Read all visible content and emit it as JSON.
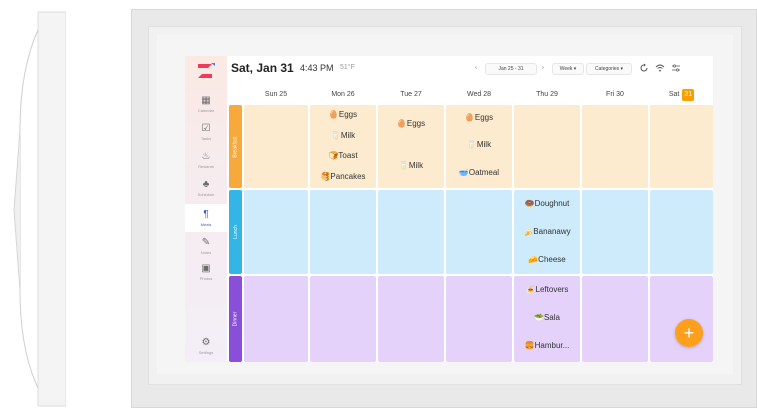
{
  "header": {
    "date": "Sat, Jan 31",
    "time": "4:43 PM",
    "weather": "51°F",
    "prev_label": "‹",
    "range_label": "Jan 25 - 31",
    "next_label": "›",
    "view_label": "Week ▾",
    "categories_label": "Categories ▾",
    "refresh_icon": "refresh-icon",
    "wifi_icon": "wifi-icon",
    "settings_icon": "sliders-icon"
  },
  "sidebar": {
    "items": [
      {
        "label": "Calendar",
        "icon": "calendar-icon",
        "glyph": "▦"
      },
      {
        "label": "Tasks",
        "icon": "tasks-icon",
        "glyph": "☑"
      },
      {
        "label": "Rewards",
        "icon": "rewards-icon",
        "glyph": "♨"
      },
      {
        "label": "Schedule",
        "icon": "schedule-icon",
        "glyph": "♣"
      },
      {
        "label": "Meals",
        "icon": "meals-icon",
        "glyph": "¶"
      },
      {
        "label": "Notes",
        "icon": "notes-icon",
        "glyph": "✎"
      },
      {
        "label": "Photos",
        "icon": "photos-icon",
        "glyph": "▣"
      },
      {
        "label": "Settings",
        "icon": "settings-icon",
        "glyph": "⚙"
      }
    ]
  },
  "days": [
    "Sun 25",
    "Mon 26",
    "Tue 27",
    "Wed 28",
    "Thu 29",
    "Fri 30",
    "Sat"
  ],
  "today_day": "31",
  "rows": [
    {
      "name": "Breakfast",
      "color": "#f7a93b",
      "cell": "#fdebd0"
    },
    {
      "name": "Lunch",
      "color": "#33b5e5",
      "cell": "#cdebfb"
    },
    {
      "name": "Dinner",
      "color": "#8a4fd8",
      "cell": "#e5d2fb"
    }
  ],
  "meals": {
    "breakfast": {
      "mon": [
        "🥚Eggs",
        "🥛Milk",
        "🍞Toast",
        "🥞Pancakes"
      ],
      "tue": [
        "🥚Eggs",
        "🥛Milk"
      ],
      "wed": [
        "🥚Eggs",
        "🥛Milk",
        "🥣Oatmeal"
      ]
    },
    "lunch": {
      "thu": [
        "🍩Doughnut",
        "🍌Bananawy",
        "🧀Cheese"
      ]
    },
    "dinner": {
      "thu": [
        "🍝Leftovers",
        "🥗Sala",
        "🍔Hambur..."
      ]
    }
  },
  "fab_label": "+",
  "colors": {
    "accent": "#3b5bdb",
    "fab": "#ff9f1c",
    "today": "#f59f00"
  }
}
